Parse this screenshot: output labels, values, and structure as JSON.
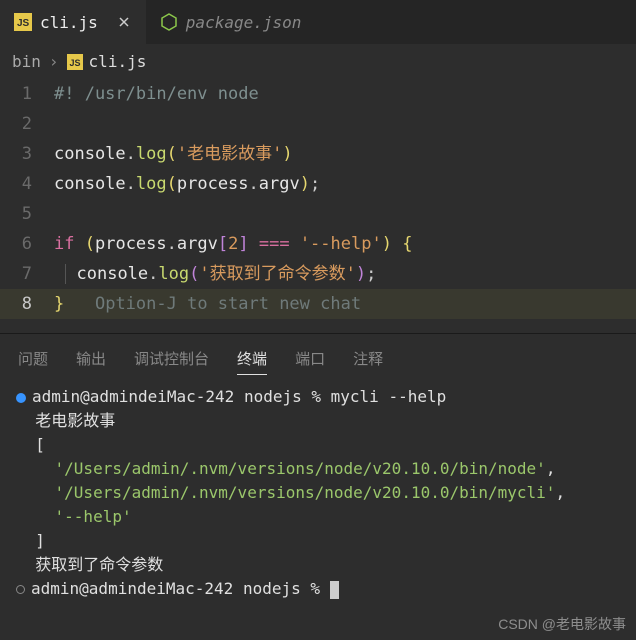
{
  "tabs": [
    {
      "label": "cli.js",
      "icon": "js",
      "active": true,
      "dirty": false
    },
    {
      "label": "package.json",
      "icon": "nodejs",
      "active": false,
      "dirty": false
    }
  ],
  "breadcrumb": {
    "folder": "bin",
    "file": "cli.js",
    "icon": "js"
  },
  "code": {
    "l1_shebang": "#! /usr/bin/env node",
    "l3": {
      "obj": "console",
      "method": "log",
      "str": "'老电影故事'"
    },
    "l4": {
      "obj": "console",
      "method": "log",
      "arg1": "process",
      "arg2": "argv"
    },
    "l6": {
      "kw": "if",
      "obj": "process",
      "prop": "argv",
      "idx": "2",
      "cmp": "===",
      "rhs": "'--help'"
    },
    "l7": {
      "obj": "console",
      "method": "log",
      "str": "'获取到了命令参数'"
    },
    "l8_ghost": "Option-J to start new chat"
  },
  "panel": {
    "tabs": [
      "问题",
      "输出",
      "调试控制台",
      "终端",
      "端口",
      "注释"
    ],
    "active_index": 3
  },
  "terminal": {
    "prompt1_host": "admin@admindeiMac-242",
    "prompt1_dir": "nodejs",
    "prompt1_cmd": "mycli --help",
    "out1": "老电影故事",
    "arr_open": "[",
    "arr_item1": "'/Users/admin/.nvm/versions/node/v20.10.0/bin/node'",
    "arr_item2": "'/Users/admin/.nvm/versions/node/v20.10.0/bin/mycli'",
    "arr_item3": "'--help'",
    "arr_close": "]",
    "out2": "获取到了命令参数",
    "prompt2_host": "admin@admindeiMac-242",
    "prompt2_dir": "nodejs"
  },
  "watermark": "CSDN @老电影故事"
}
